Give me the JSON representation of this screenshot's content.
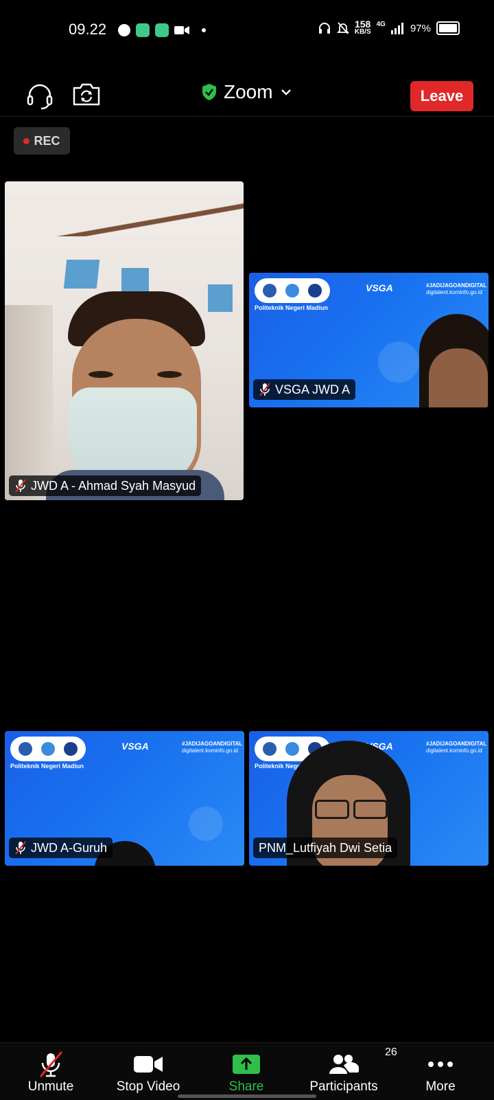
{
  "status_bar": {
    "time": "09.22",
    "speed_value": "158",
    "speed_unit": "KB/S",
    "network": "4G",
    "battery": "97%"
  },
  "toolbar": {
    "meeting_title": "Zoom",
    "leave_label": "Leave",
    "rec_label": "REC"
  },
  "participants": [
    {
      "name": "JWD A - Ahmad Syah Masyud",
      "muted": true
    },
    {
      "name": "VSGA JWD A",
      "muted": true
    },
    {
      "name": "JWD A-Guruh",
      "muted": true
    },
    {
      "name": "PNM_Lutfiyah Dwi Setia",
      "muted": false
    }
  ],
  "banner": {
    "institution": "Politeknik Negeri Madiun",
    "program": "VSGA",
    "hashtag": "#JADIJAGOANDIGITAL",
    "website": "digitalent.kominfo.go.id"
  },
  "bottom_bar": {
    "unmute_label": "Unmute",
    "stop_video_label": "Stop Video",
    "share_label": "Share",
    "participants_label": "Participants",
    "participants_count": "26",
    "more_label": "More"
  },
  "colors": {
    "leave": "#e02828",
    "share": "#2fbf4a",
    "shield": "#2fbf4a",
    "tile_blue": "#1872f0"
  }
}
